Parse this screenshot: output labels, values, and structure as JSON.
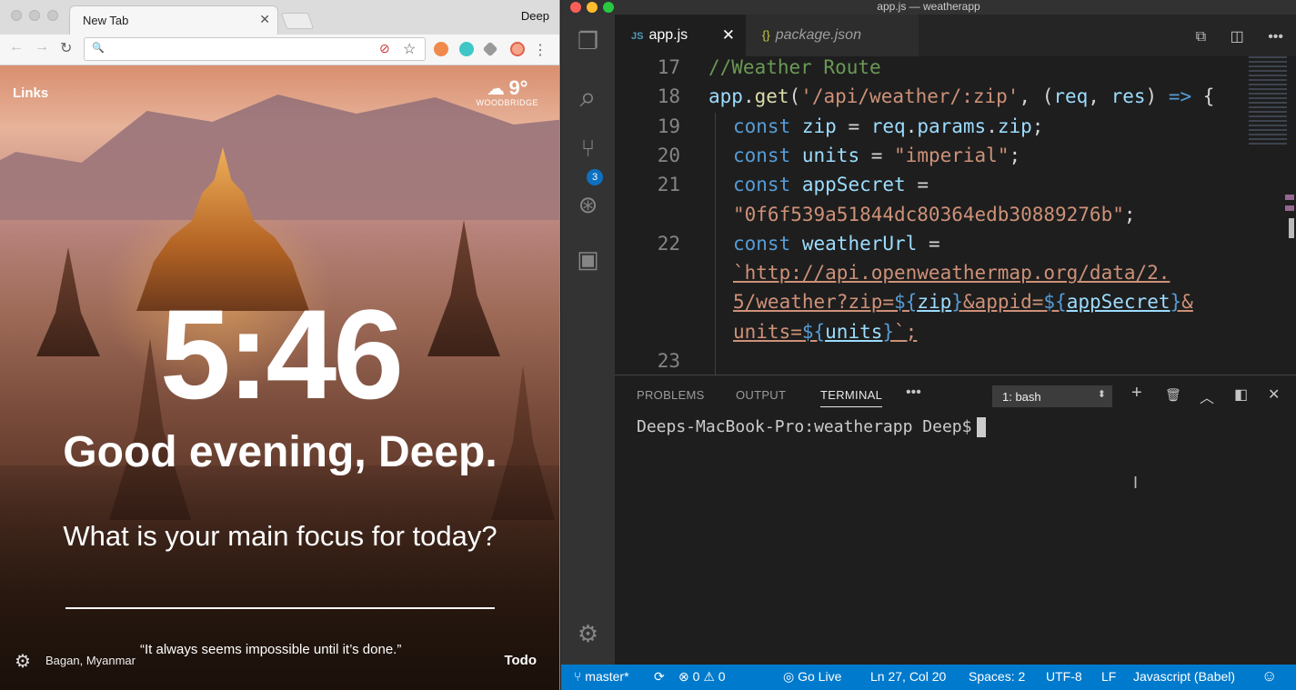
{
  "chrome": {
    "tab_title": "New Tab",
    "tab_close": "✕",
    "profile_name": "Deep",
    "nav_icons": {
      "back": "←",
      "forward": "→",
      "reload": "↻"
    },
    "omnibox_icon": "search-icon",
    "omnibox_search_glyph": "🔍",
    "bookmark_glyph": "☆",
    "blocked_glyph": "⊘",
    "menu_glyph": "⋮",
    "extensions": [
      "orange-extension",
      "teal-extension",
      "gray-extension",
      "red-extension"
    ]
  },
  "momentum": {
    "links_label": "Links",
    "weather": {
      "icon": "☁",
      "temperature": "9°",
      "location": "WOODBRIDGE"
    },
    "time": "5:46",
    "greeting": "Good evening, Deep.",
    "focus_question": "What is your main focus for today?",
    "settings_glyph": "⚙",
    "photo_location": "Bagan, Myanmar",
    "quote": "“It always seems impossible until it’s done.”",
    "todo_label": "Todo"
  },
  "vscode": {
    "window_title": "app.js — weatherapp",
    "activity_icons": {
      "explorer": "❐",
      "search": "⌕",
      "scm": "⑂",
      "debug": "⊛",
      "extensions": "▣",
      "settings": "⚙"
    },
    "scm_badge": "3",
    "tabs": [
      {
        "badge": "JS",
        "label": "app.js",
        "close": "✕"
      },
      {
        "badge": "{}",
        "label": "package.json"
      }
    ],
    "editor_actions": {
      "open_preview": "⧉",
      "split": "◫",
      "more": "•••"
    },
    "code_lines": [
      {
        "num": "17",
        "text": "//Weather Route"
      },
      {
        "num": "18",
        "text": "app.get('/api/weather/:zip', (req, res) => {"
      },
      {
        "num": "19",
        "text": "const zip = req.params.zip;"
      },
      {
        "num": "20",
        "text": "const units = \"imperial\";"
      },
      {
        "num": "21",
        "text": "const appSecret ="
      },
      {
        "num": "",
        "text": "\"0f6f539a51844dc80364edb30889276b\";"
      },
      {
        "num": "22",
        "text": "const weatherUrl ="
      },
      {
        "num": "",
        "text": "`http://api.openweathermap.org/data/2."
      },
      {
        "num": "",
        "text": "5/weather?zip=${zip}&appid=${appSecret}&"
      },
      {
        "num": "",
        "text": "units=${units}`;"
      },
      {
        "num": "23",
        "text": ""
      }
    ],
    "panel": {
      "tabs": [
        "PROBLEMS",
        "OUTPUT",
        "TERMINAL"
      ],
      "active_tab": "TERMINAL",
      "more": "•••",
      "terminal_select": "1: bash",
      "select_caret": "⬍",
      "actions": {
        "new": "+",
        "trash": "🗑",
        "maximize": "︿",
        "split": "◧",
        "close": "✕"
      },
      "prompt": "Deeps-MacBook-Pro:weatherapp Deep$",
      "ibeam": "I"
    },
    "status": {
      "branch": "master*",
      "sync_glyph": "⟳",
      "errors": "0",
      "warnings": "0",
      "error_glyph": "⊗",
      "warning_glyph": "⚠",
      "go_live": "Go Live",
      "go_live_glyph": "◎",
      "position": "Ln 27, Col 20",
      "spaces": "Spaces: 2",
      "encoding": "UTF-8",
      "eol": "LF",
      "language": "Javascript (Babel)",
      "feedback_glyph": "☺"
    }
  }
}
